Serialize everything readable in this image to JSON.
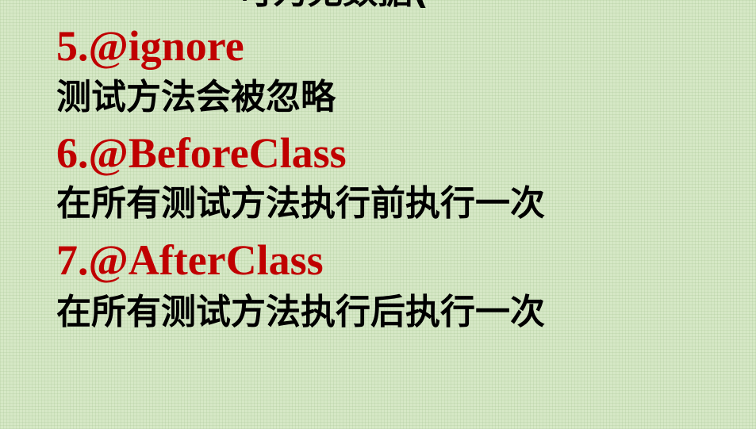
{
  "slide": {
    "clipped_top_text": "可为无数据(",
    "items": [
      {
        "heading": "5.@ignore",
        "description": "测试方法会被忽略"
      },
      {
        "heading": "6.@BeforeClass",
        "description": "在所有测试方法执行前执行一次"
      },
      {
        "heading": "7.@AfterClass",
        "description": "在所有测试方法执行后执行一次"
      }
    ]
  },
  "colors": {
    "background": "#d6e8c6",
    "heading": "#c00000",
    "text": "#000000"
  }
}
